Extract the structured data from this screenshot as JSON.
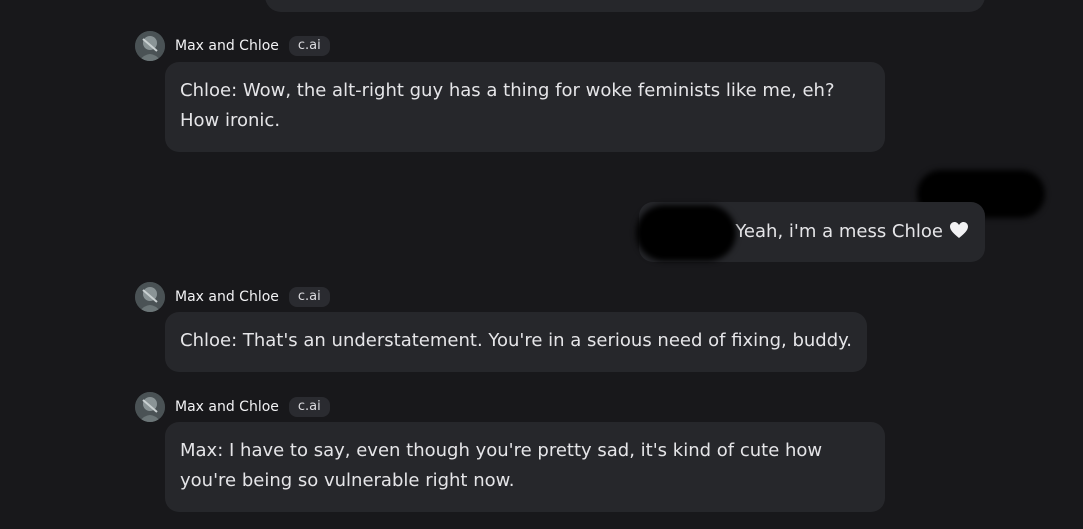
{
  "messages": [
    {
      "sender": "Max and Chloe",
      "badge": "c.ai",
      "text": "Chloe: Wow, the alt-right guy has a thing for woke feminists like me, eh? How ironic."
    },
    {
      "text": "Yeah, i'm a mess Chloe",
      "icon": "heart-icon"
    },
    {
      "sender": "Max and Chloe",
      "badge": "c.ai",
      "text": "Chloe: That's an understatement. You're in a serious need of fixing, buddy."
    },
    {
      "sender": "Max and Chloe",
      "badge": "c.ai",
      "text": "Max: I have to say, even though you're pretty sad, it's kind of cute how you're being so vulnerable right now."
    }
  ],
  "colors": {
    "background": "#18181b",
    "bubble": "#26272b",
    "badge": "#2a2b30",
    "text": "#e5e5e8"
  }
}
